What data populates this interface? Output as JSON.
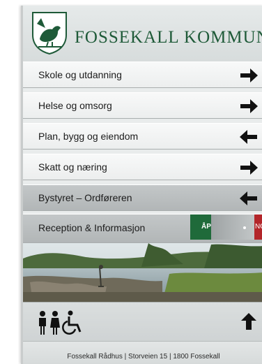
{
  "header": {
    "crest": "bird-crest-icon",
    "title": "FOSSEKALL KOMMUNE",
    "title_color": "#1e5a38"
  },
  "directory": [
    {
      "label": "Skole og utdanning",
      "arrow": "arrow-right-icon"
    },
    {
      "label": "Helse og omsorg",
      "arrow": "arrow-right-icon"
    },
    {
      "label": "Plan, bygg og eiendom",
      "arrow": "arrow-left-icon"
    },
    {
      "label": "Skatt og næring",
      "arrow": "arrow-right-icon"
    },
    {
      "label": "Bystyret – Ordføreren",
      "arrow": "arrow-left-icon"
    }
  ],
  "reception": {
    "label": "Reception & Informasjon",
    "status_open": "ÅP",
    "status_closed": "NG",
    "open_color": "#1f6a3a",
    "closed_color": "#b3262a"
  },
  "photo": {
    "subject": "lake-shore-photo"
  },
  "facilities": {
    "icons": [
      "men-icon",
      "women-icon",
      "wheelchair-icon"
    ],
    "arrow": "arrow-up-icon"
  },
  "footer": {
    "text": "Fossekall Rådhus | Storveien 15 | 1800 Fossekall"
  }
}
